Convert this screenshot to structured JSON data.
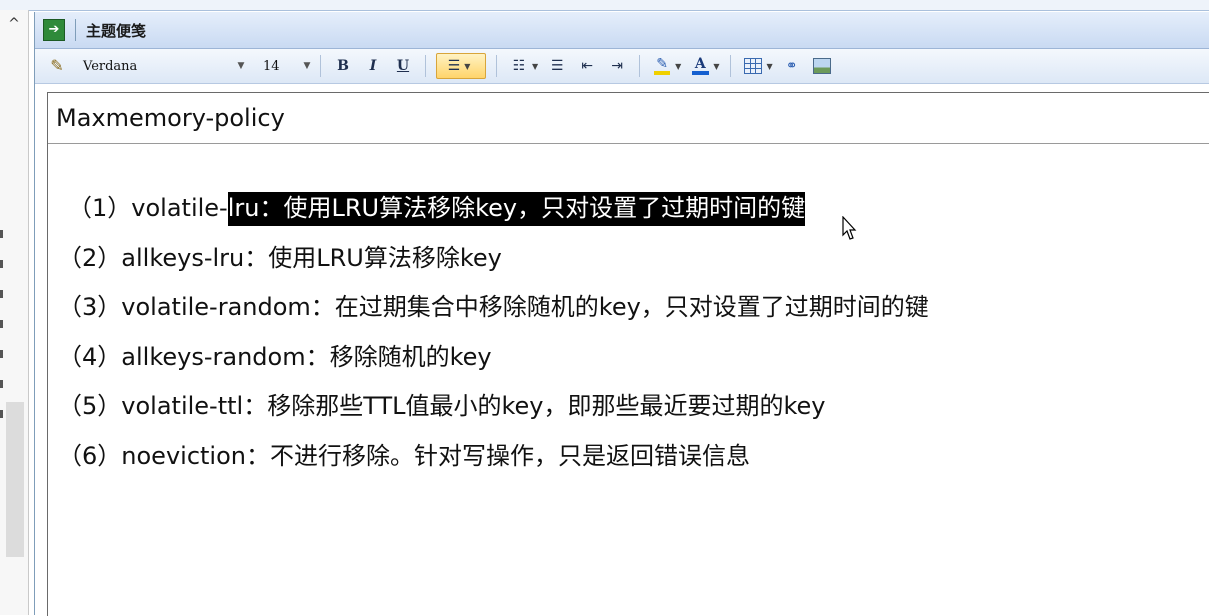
{
  "window": {
    "title": "主题便笺"
  },
  "toolbar": {
    "font_family": "Verdana",
    "font_size": "14",
    "bold_label": "B",
    "italic_label": "I",
    "underline_label": "U",
    "font_color_label": "A"
  },
  "note": {
    "heading": "Maxmemory-policy",
    "items": [
      {
        "num": "（1）",
        "pre": "volatile-",
        "selected": "lru：使用LRU算法移除key，只对设置了过期时间的键",
        "post": ""
      },
      {
        "num": "（2）",
        "text": "allkeys-lru：使用LRU算法移除key"
      },
      {
        "num": "（3）",
        "text": "volatile-random：在过期集合中移除随机的key，只对设置了过期时间的键"
      },
      {
        "num": "（4）",
        "text": "allkeys-random：移除随机的key"
      },
      {
        "num": "（5）",
        "text": "volatile-ttl：移除那些TTL值最小的key，即那些最近要过期的key"
      },
      {
        "num": "（6）",
        "text": "noeviction：不进行移除。针对写操作，只是返回错误信息"
      }
    ]
  },
  "colors": {
    "selection_bg": "#000000",
    "selection_fg": "#ffffff",
    "active_button": "#ffd46a",
    "highlight_pen": "#f0d000",
    "font_color": "#1560d0"
  }
}
